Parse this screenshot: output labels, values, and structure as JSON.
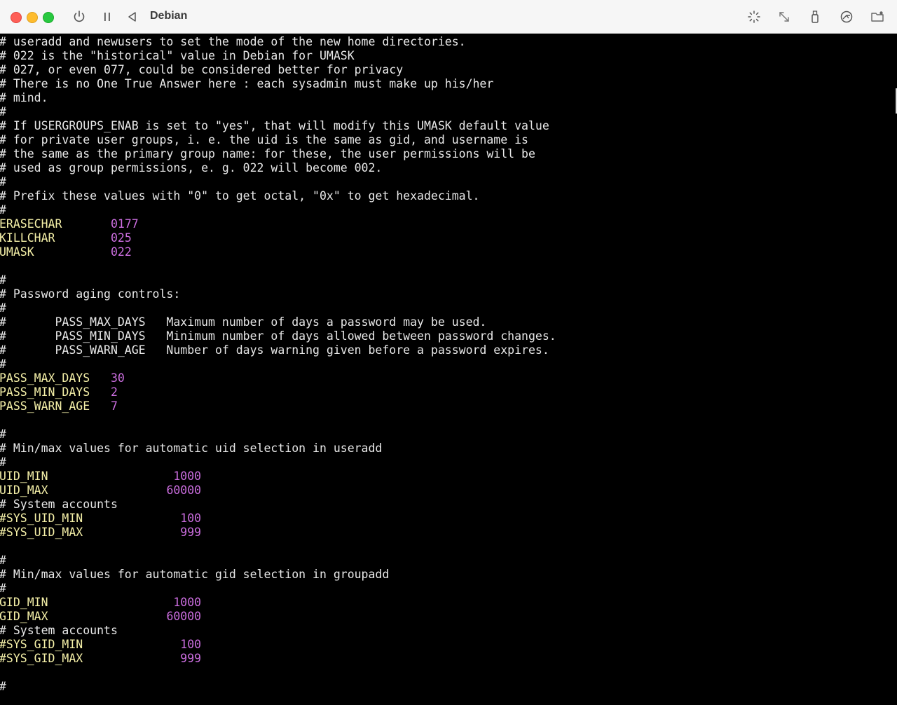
{
  "window": {
    "title": "Debian",
    "toolbar_icons": [
      "power-icon",
      "pause-icon",
      "back-icon",
      "brightness-icon",
      "resize-icon",
      "usb-icon",
      "network-icon",
      "folder-share-icon"
    ]
  },
  "terminal": {
    "colors": {
      "comment": "#e8e8e8",
      "key": "#f5f0a8",
      "value": "#cc6ee0",
      "background": "#000000"
    },
    "lines": [
      {
        "text": "# useradd and newusers to set the mode of the new home directories."
      },
      {
        "text": "# 022 is the \"historical\" value in Debian for UMASK"
      },
      {
        "text": "# 027, or even 077, could be considered better for privacy"
      },
      {
        "text": "# There is no One True Answer here : each sysadmin must make up his/her"
      },
      {
        "text": "# mind."
      },
      {
        "text": "#"
      },
      {
        "text": "# If USERGROUPS_ENAB is set to \"yes\", that will modify this UMASK default value"
      },
      {
        "text": "# for private user groups, i. e. the uid is the same as gid, and username is"
      },
      {
        "text": "# the same as the primary group name: for these, the user permissions will be"
      },
      {
        "text": "# used as group permissions, e. g. 022 will become 002."
      },
      {
        "text": "#"
      },
      {
        "text": "# Prefix these values with \"0\" to get octal, \"0x\" to get hexadecimal."
      },
      {
        "text": "#"
      },
      {
        "key": "ERASECHAR",
        "gap": "       ",
        "value": "0177"
      },
      {
        "key": "KILLCHAR",
        "gap": "        ",
        "value": "025"
      },
      {
        "key": "UMASK",
        "gap": "           ",
        "value": "022"
      },
      {
        "text": ""
      },
      {
        "text": "#"
      },
      {
        "text": "# Password aging controls:"
      },
      {
        "text": "#"
      },
      {
        "text": "#       PASS_MAX_DAYS   Maximum number of days a password may be used."
      },
      {
        "text": "#       PASS_MIN_DAYS   Minimum number of days allowed between password changes."
      },
      {
        "text": "#       PASS_WARN_AGE   Number of days warning given before a password expires."
      },
      {
        "text": "#"
      },
      {
        "key": "PASS_MAX_DAYS",
        "gap": "   ",
        "value": "30"
      },
      {
        "key": "PASS_MIN_DAYS",
        "gap": "   ",
        "value": "2"
      },
      {
        "key": "PASS_WARN_AGE",
        "gap": "   ",
        "value": "7"
      },
      {
        "text": ""
      },
      {
        "text": "#"
      },
      {
        "text": "# Min/max values for automatic uid selection in useradd"
      },
      {
        "text": "#"
      },
      {
        "key": "UID_MIN",
        "gap": "                  ",
        "value": "1000"
      },
      {
        "key": "UID_MAX",
        "gap": "                 ",
        "value": "60000"
      },
      {
        "text": "# System accounts"
      },
      {
        "key": "#SYS_UID_MIN",
        "gap": "              ",
        "value": "100"
      },
      {
        "key": "#SYS_UID_MAX",
        "gap": "              ",
        "value": "999"
      },
      {
        "text": ""
      },
      {
        "text": "#"
      },
      {
        "text": "# Min/max values for automatic gid selection in groupadd"
      },
      {
        "text": "#"
      },
      {
        "key": "GID_MIN",
        "gap": "                  ",
        "value": "1000"
      },
      {
        "key": "GID_MAX",
        "gap": "                 ",
        "value": "60000"
      },
      {
        "text": "# System accounts"
      },
      {
        "key": "#SYS_GID_MIN",
        "gap": "              ",
        "value": "100"
      },
      {
        "key": "#SYS_GID_MAX",
        "gap": "              ",
        "value": "999"
      },
      {
        "text": ""
      },
      {
        "text": "#"
      }
    ]
  }
}
